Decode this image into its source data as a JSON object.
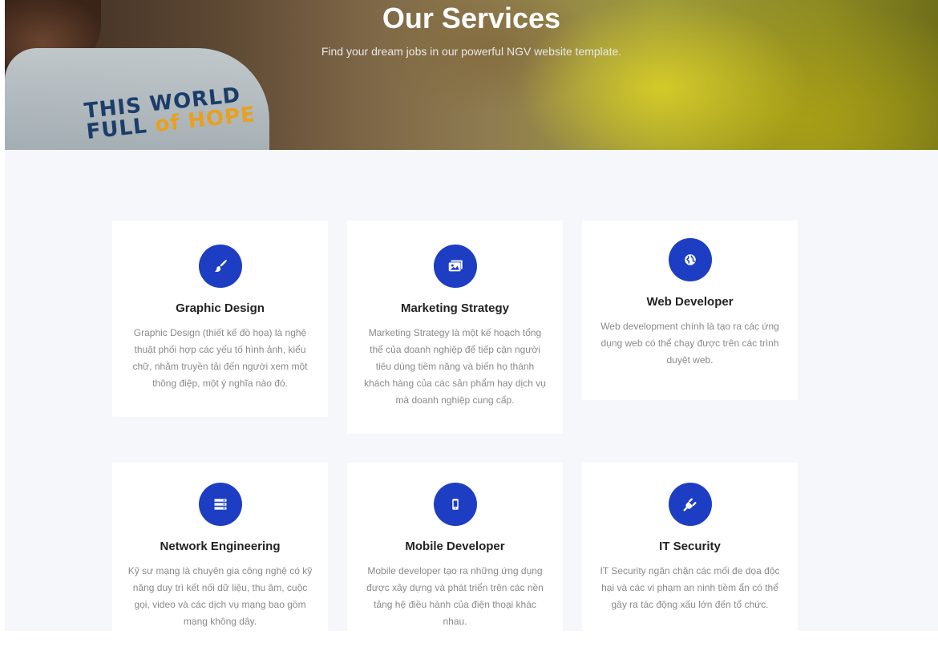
{
  "hero": {
    "title": "Our Services",
    "subtitle": "Find your dream jobs in our powerful NGV website template."
  },
  "accent_color": "#1d3ec2",
  "services": [
    {
      "title": "Graphic Design",
      "icon": "paint-brush-icon",
      "description": "Graphic Design (thiết kế đồ họa) là nghệ thuật phối hợp các yếu tố hình ảnh, kiểu chữ, nhằm truyền tải đến người xem một thông điệp, một ý nghĩa nào đó."
    },
    {
      "title": "Marketing Strategy",
      "icon": "images-icon",
      "description": "Marketing Strategy là một kế hoạch tổng thể của doanh nghiệp để tiếp cận người tiêu dùng tiềm năng và biến họ thành khách hàng của các sản phẩm hay dịch vụ mà doanh nghiệp cung cấp."
    },
    {
      "title": "Web Developer",
      "icon": "globe-icon",
      "description": "Web development chính là tạo ra các ứng dụng web có thể chạy được trên các trình duyệt web."
    },
    {
      "title": "Network Engineering",
      "icon": "server-icon",
      "description": "Kỹ sư mạng là chuyên gia công nghệ có kỹ năng duy trì kết nối dữ liệu, thu âm, cuộc gọi, video và các dịch vụ mạng bao gồm mạng không dây."
    },
    {
      "title": "Mobile Developer",
      "icon": "mobile-icon",
      "description": "Mobile developer tạo ra những ứng dụng được xây dựng và phát triển trên các nền tảng hệ điều hành của điện thoại khác nhau."
    },
    {
      "title": "IT Security",
      "icon": "plug-icon",
      "description": "IT Security ngăn chặn các mối đe dọa độc hại và các vi phạm an ninh tiềm ẩn có thể gây ra tác động xấu lớn đến tổ chức."
    }
  ]
}
